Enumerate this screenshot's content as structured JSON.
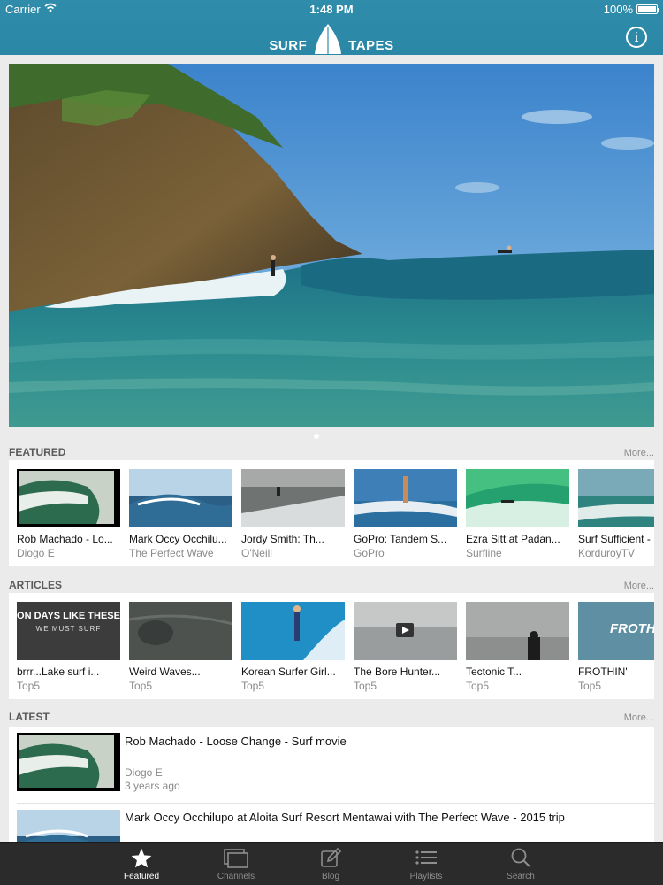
{
  "status": {
    "carrier": "Carrier",
    "time": "1:48 PM",
    "battery": "100%"
  },
  "header": {
    "logo_left": "SURF",
    "logo_right": "TAPES",
    "info_label": "i"
  },
  "sections": {
    "featured": {
      "title": "FEATURED",
      "more": "More...",
      "items": [
        {
          "title": "Rob Machado - Lo...",
          "sub": "Diogo E"
        },
        {
          "title": "Mark Occy Occhilu...",
          "sub": "The Perfect Wave"
        },
        {
          "title": "Jordy Smith: Th...",
          "sub": "O'Neill"
        },
        {
          "title": "GoPro: Tandem S...",
          "sub": "GoPro"
        },
        {
          "title": "Ezra Sitt at Padan...",
          "sub": "Surfline"
        },
        {
          "title": "Surf Sufficient -",
          "sub": "KorduroyTV"
        }
      ]
    },
    "articles": {
      "title": "ARTICLES",
      "more": "More...",
      "items": [
        {
          "title": "brrr...Lake surf i...",
          "sub": "Top5",
          "thumb_line1": "ON DAYS LIKE THESE",
          "thumb_line2": "WE MUST SURF"
        },
        {
          "title": "Weird Waves...",
          "sub": "Top5"
        },
        {
          "title": "Korean Surfer Girl...",
          "sub": "Top5"
        },
        {
          "title": "The Bore Hunter...",
          "sub": "Top5"
        },
        {
          "title": "Tectonic T...",
          "sub": "Top5"
        },
        {
          "title": "FROTHIN'",
          "sub": "Top5",
          "thumb_text": "FROTHIN"
        }
      ]
    },
    "latest": {
      "title": "LATEST",
      "more": "More...",
      "items": [
        {
          "title": "Rob Machado - Loose Change - Surf movie",
          "author": "Diogo E",
          "time": "3 years ago"
        },
        {
          "title": "Mark Occy Occhilupo at Aloita Surf Resort Mentawai with The Perfect Wave - 2015 trip"
        }
      ]
    }
  },
  "tabbar": {
    "tabs": [
      {
        "label": "Featured",
        "icon": "star-icon",
        "active": true
      },
      {
        "label": "Channels",
        "icon": "channels-icon",
        "active": false
      },
      {
        "label": "Blog",
        "icon": "blog-icon",
        "active": false
      },
      {
        "label": "Playlists",
        "icon": "playlists-icon",
        "active": false
      },
      {
        "label": "Search",
        "icon": "search-icon",
        "active": false
      }
    ]
  },
  "colors": {
    "header": "#2f8dab",
    "tabbar": "#2b2b2b",
    "active_tab": "#ffffff",
    "inactive_tab": "#8e8e8e"
  }
}
